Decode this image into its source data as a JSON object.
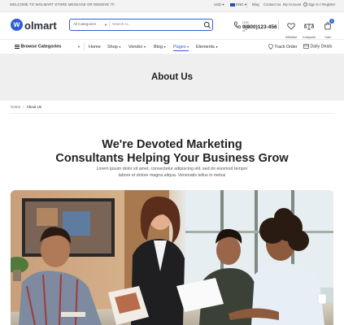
{
  "topbar": {
    "welcome": "WELCOME TO WOLMART STORE MESSAGE OR REMOVE IT!",
    "currency": "USD",
    "language": "ENG",
    "links": [
      "Blog",
      "Contact Us",
      "My Account",
      "Sign In / Register"
    ]
  },
  "header": {
    "logo_mark": "w",
    "logo_text": "olmart",
    "search": {
      "category": "All Categories",
      "placeholder": "Search in..."
    },
    "live_chat_label": "Live Chat or :",
    "phone": "0(800)123-456",
    "wishlist_label": "Wishlist",
    "compare_label": "Compare",
    "cart_label": "Cart",
    "cart_count": "0"
  },
  "nav": {
    "browse_label": "Browse Categories",
    "links": [
      "Home",
      "Shop",
      "Vendor",
      "Blog",
      "Pages",
      "Elements"
    ],
    "track_order": "Track Order",
    "daily_deals": "Daily Deals"
  },
  "page": {
    "hero_title": "About Us",
    "breadcrumb_home": "Home",
    "breadcrumb_sep": "/",
    "breadcrumb_current": "About Us",
    "heading_line1": "We're Devoted Marketing",
    "heading_line2": "Consultants Helping Your Business Grow",
    "lead_line1": "Lorem ipsum dolor sit amet, consectetur adipiscing elit, sed do eiusmod tempor",
    "lead_line2": "labore et dolore magna aliqua. Venenatis tellus in metus"
  },
  "colors": {
    "accent": "#2e5fd3",
    "hero_bg": "#efefef"
  }
}
